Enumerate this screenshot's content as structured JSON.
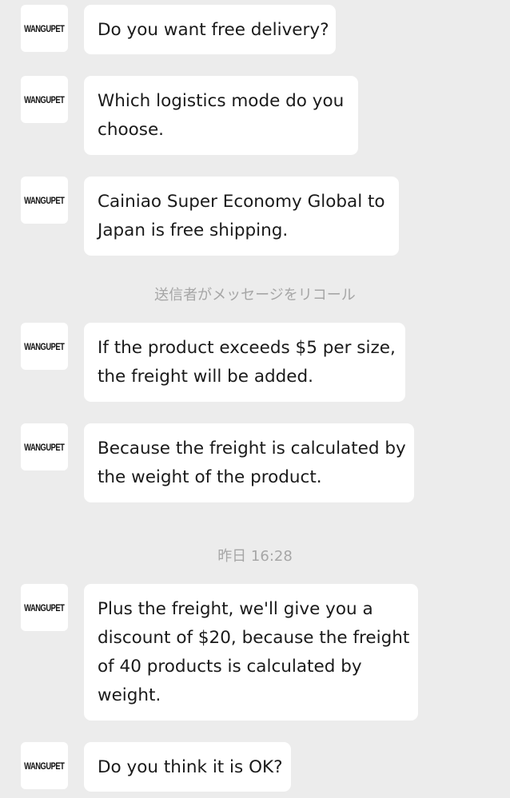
{
  "avatar": {
    "label": "WANGUPET"
  },
  "messages": [
    {
      "lines": [
        "Do you want free delivery?"
      ]
    },
    {
      "lines": [
        "Which logistics mode do you",
        "choose."
      ]
    },
    {
      "lines": [
        "Cainiao Super Economy Global to",
        "Japan is free shipping."
      ]
    },
    {
      "lines": [
        "If the product exceeds $5 per size,",
        "the freight will be added."
      ]
    },
    {
      "lines": [
        "Because the freight is calculated by",
        "the weight of the product."
      ]
    },
    {
      "lines": [
        "Plus the freight, we'll give you a",
        "discount of $20, because the freight",
        "of 40 products is calculated by",
        "weight."
      ]
    },
    {
      "lines": [
        "Do you think it is OK?"
      ]
    }
  ],
  "system_notes": {
    "recall": "送信者がメッセージをリコール",
    "timestamp": "昨日 16:28"
  }
}
